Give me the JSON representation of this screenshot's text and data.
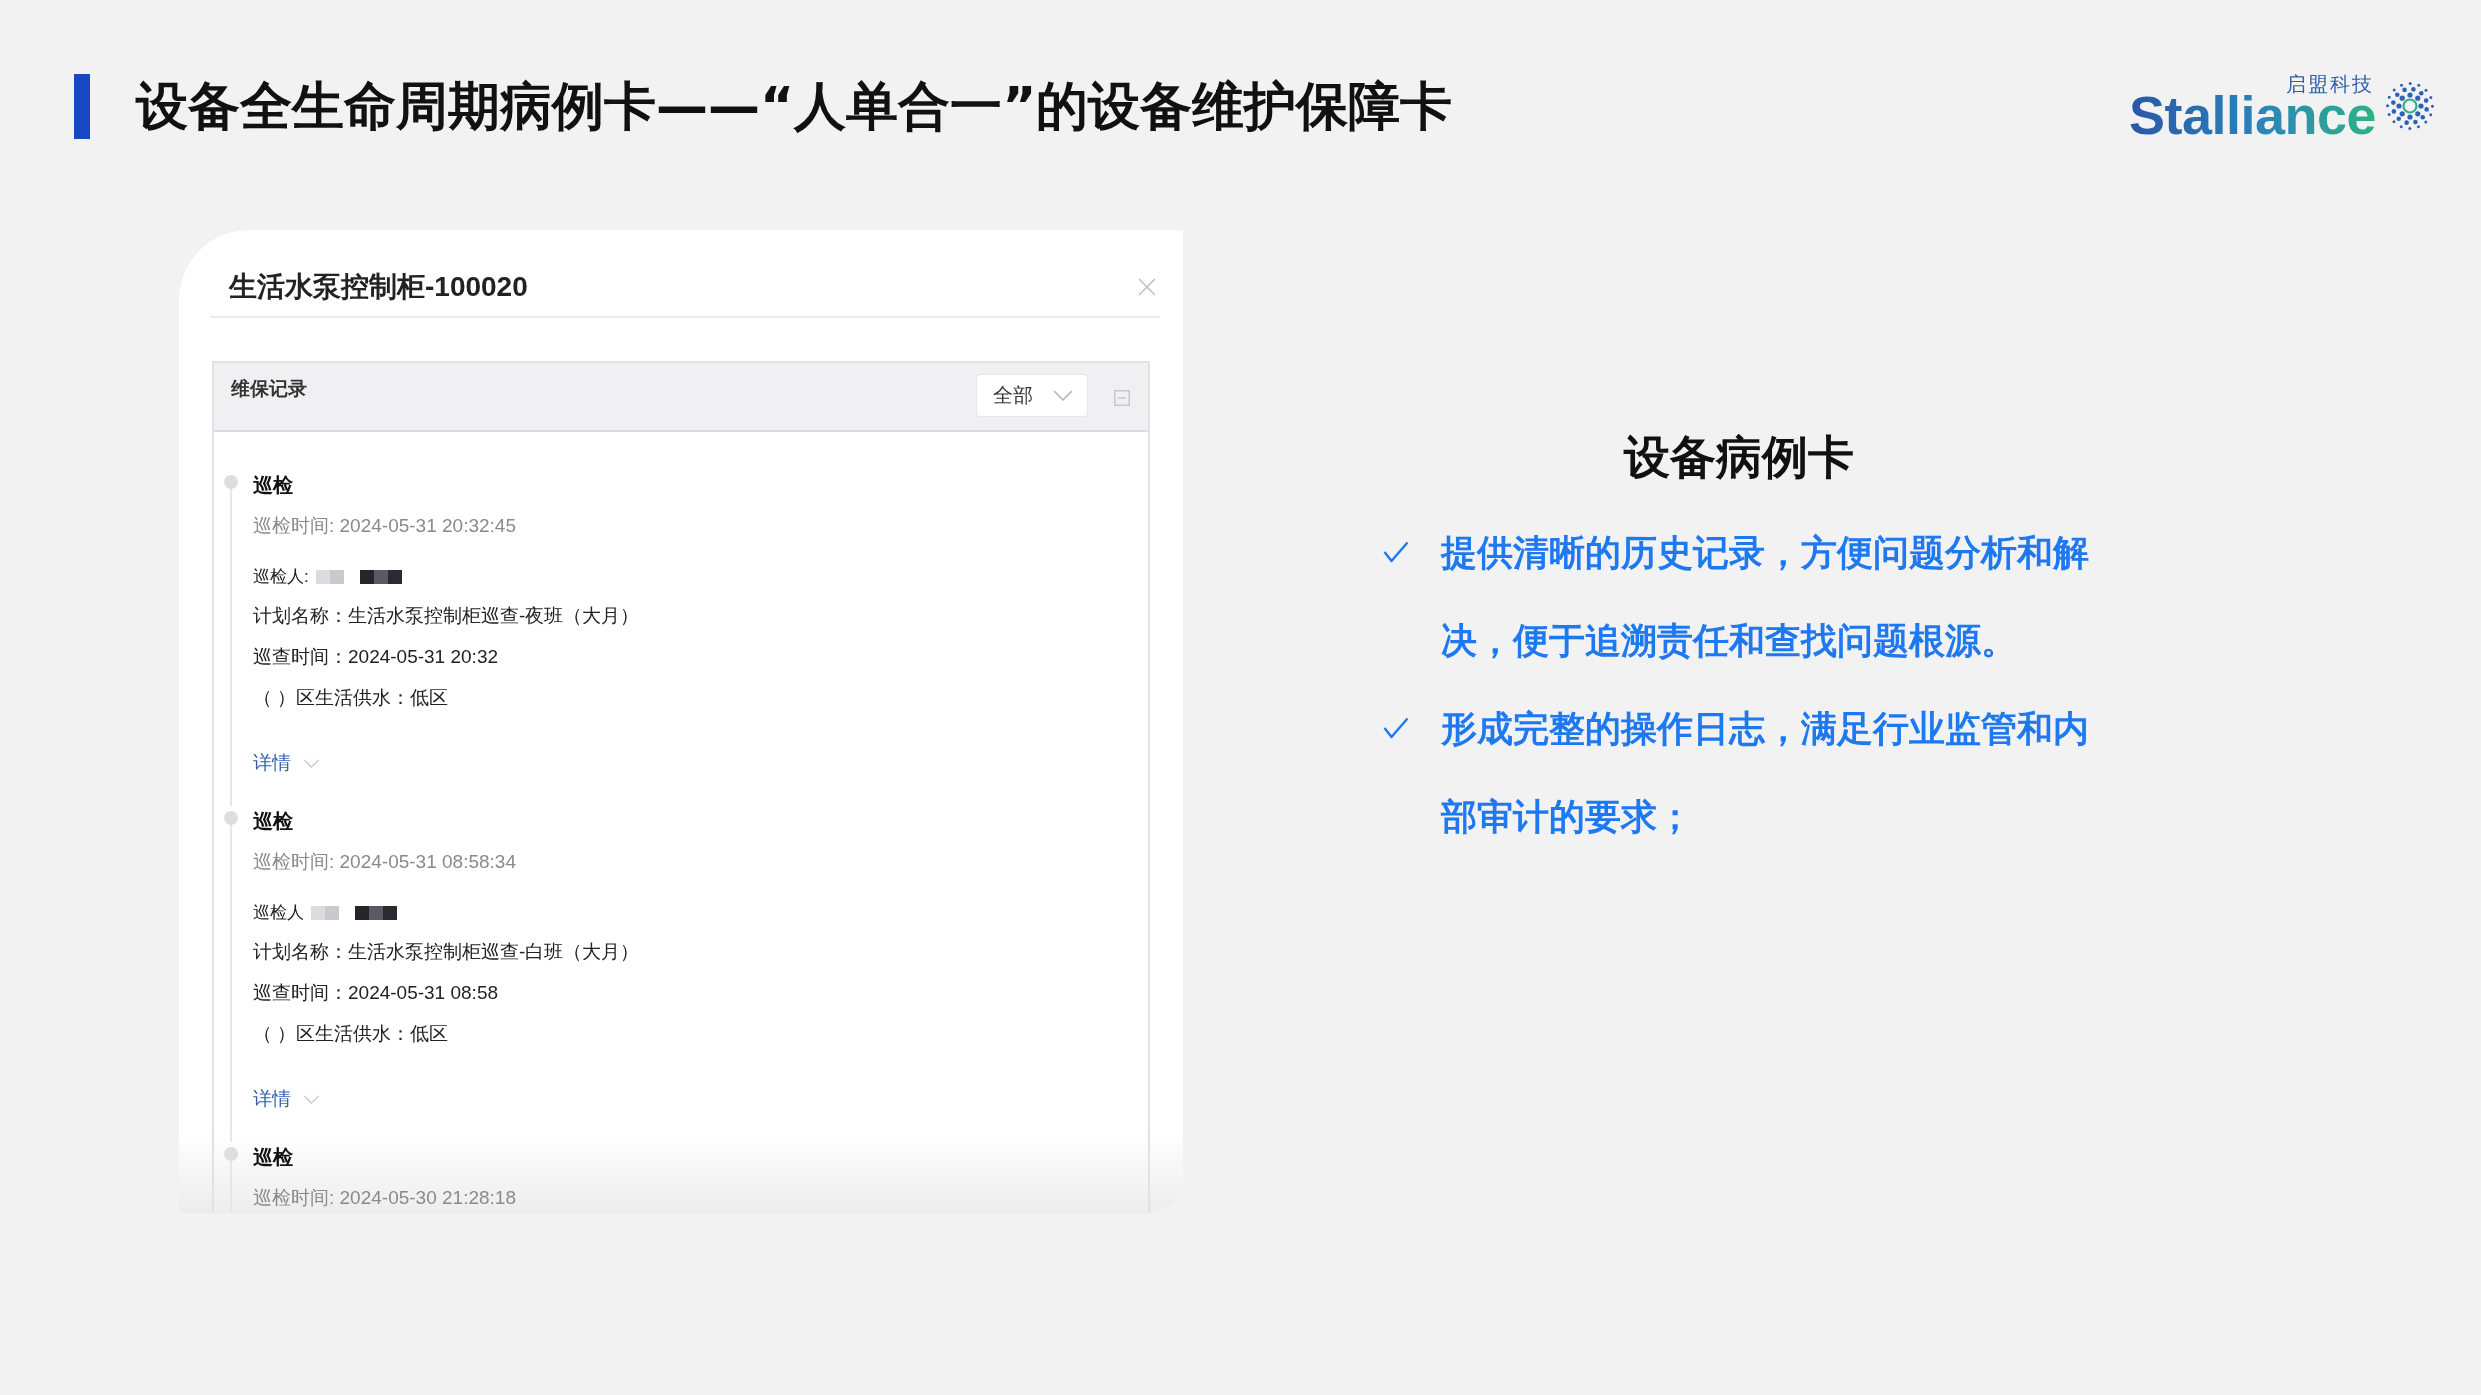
{
  "header": {
    "title": "设备全生命周期病例卡——“人单合一”的设备维护保障卡",
    "logo": {
      "wordmark": "Stalliance",
      "tagline": "启盟科技"
    }
  },
  "device_card": {
    "title": "生活水泵控制柜-100020",
    "panel": {
      "title": "维保记录",
      "filter": "全部",
      "records": [
        {
          "type": "巡检",
          "time": "巡检时间: 2024-05-31 20:32:45",
          "inspector_label": "巡检人:",
          "fields": [
            "计划名称：生活水泵控制柜巡查-夜班（大月）",
            "巡查时间：2024-05-31 20:32",
            "（ ）区生活供水：低区"
          ],
          "details_link": "详情"
        },
        {
          "type": "巡检",
          "time": "巡检时间: 2024-05-31 08:58:34",
          "inspector_label": "巡检人",
          "fields": [
            "计划名称：生活水泵控制柜巡查-白班（大月）",
            "巡查时间：2024-05-31 08:58",
            "（ ）区生活供水：低区"
          ],
          "details_link": "详情"
        },
        {
          "type": "巡检",
          "time": "巡检时间: 2024-05-30 21:28:18"
        }
      ]
    }
  },
  "feature_panel": {
    "title": "设备病例卡",
    "points": [
      "提供清晰的历史记录，方便问题分析和解决，便于追溯责任和查找问题根源。",
      "形成完整的操作日志，满足行业监管和内部审计的要求；"
    ]
  }
}
